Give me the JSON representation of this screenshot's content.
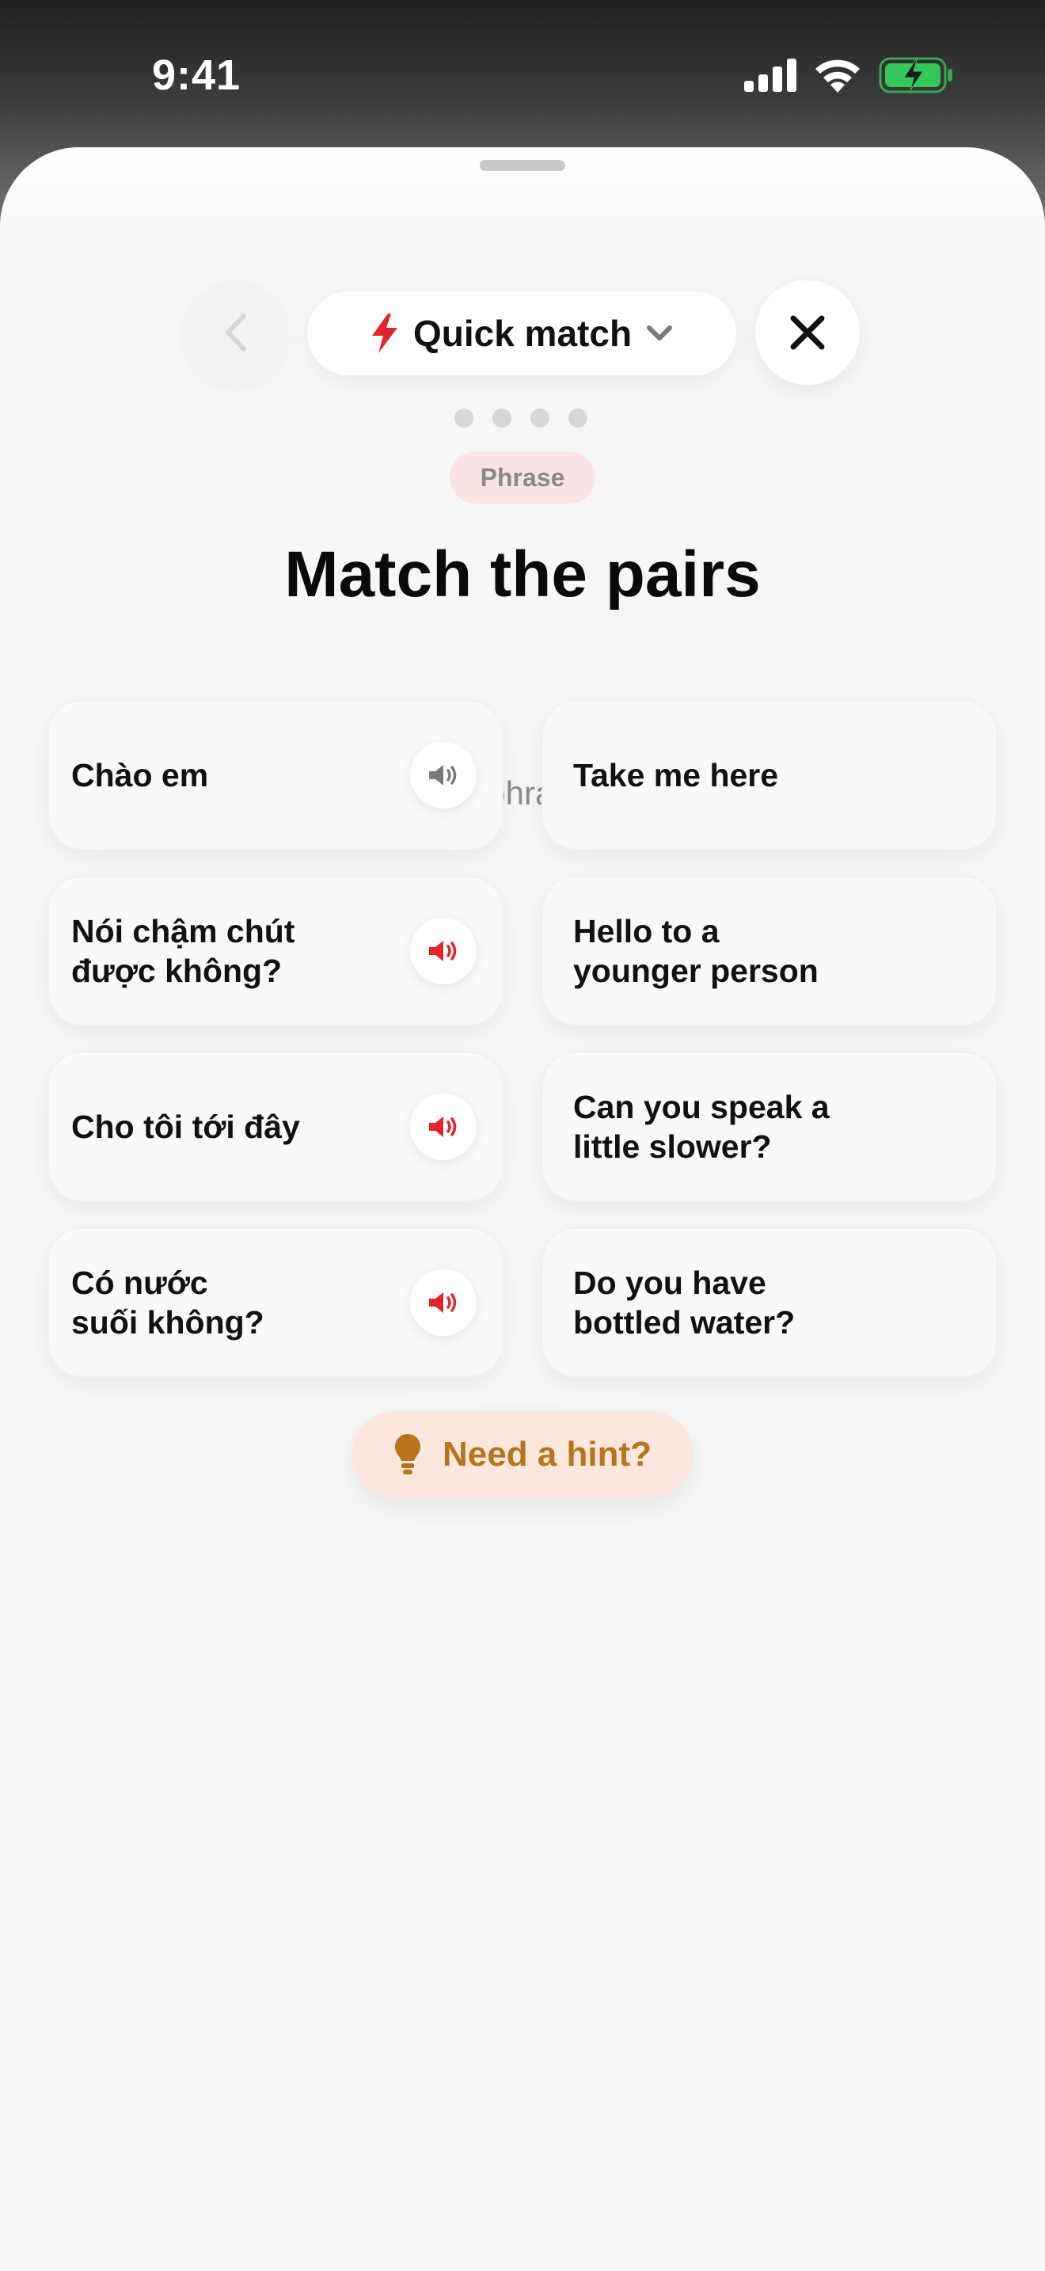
{
  "status_bar": {
    "time": "9:41"
  },
  "nav": {
    "mode_label": "Quick match",
    "mode_icon": "lightning-bolt-icon",
    "accent_color": "#e0252d"
  },
  "progress": {
    "total_dots": 4
  },
  "badge": {
    "label": "Phrase"
  },
  "header": {
    "title": "Match the pairs",
    "subtitle": "Tap the Vietnamese phrase, then its meaning."
  },
  "pairs": {
    "left": [
      {
        "text": "Chào em",
        "audio_state": "played"
      },
      {
        "text": "Nói chậm chút\nđược không?",
        "audio_state": "ready"
      },
      {
        "text": "Cho tôi tới đây",
        "audio_state": "ready"
      },
      {
        "text": "Có nước\nsuối không?",
        "audio_state": "ready"
      }
    ],
    "right": [
      {
        "text": "Take me here"
      },
      {
        "text": "Hello to a\nyounger person"
      },
      {
        "text": "Can you speak a\nlittle slower?"
      },
      {
        "text": "Do you have\nbottled water?"
      }
    ]
  },
  "hint": {
    "label": "Need a hint?",
    "icon": "lightbulb-icon"
  }
}
